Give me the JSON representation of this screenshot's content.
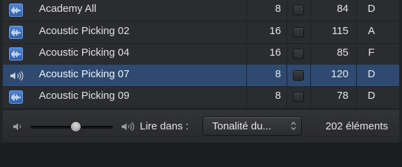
{
  "rows": [
    {
      "name": "Academy All",
      "bars": "8",
      "tempo": "84",
      "key": "D",
      "selected": false
    },
    {
      "name": "Acoustic Picking 02",
      "bars": "16",
      "tempo": "115",
      "key": "A",
      "selected": false
    },
    {
      "name": "Acoustic Picking 04",
      "bars": "16",
      "tempo": "85",
      "key": "F",
      "selected": false
    },
    {
      "name": "Acoustic Picking 07",
      "bars": "8",
      "tempo": "120",
      "key": "D",
      "selected": true
    },
    {
      "name": "Acoustic Picking 09",
      "bars": "8",
      "tempo": "78",
      "key": "D",
      "selected": false
    }
  ],
  "footer": {
    "volume_level": 0.55,
    "play_in_label": "Lire dans :",
    "play_in_value": "Tonalité du...",
    "item_count": "202 éléments"
  },
  "icons": {
    "row_icon": "audio-waveform-icon",
    "selected_row_icon": "speaker-playing-icon",
    "volume_low": "speaker-low-icon",
    "volume_high": "speaker-high-icon",
    "popup_arrows": "up-down-arrows-icon"
  },
  "colors": {
    "selection": "#2f4a70",
    "icon_blue": "#3f75c8"
  }
}
